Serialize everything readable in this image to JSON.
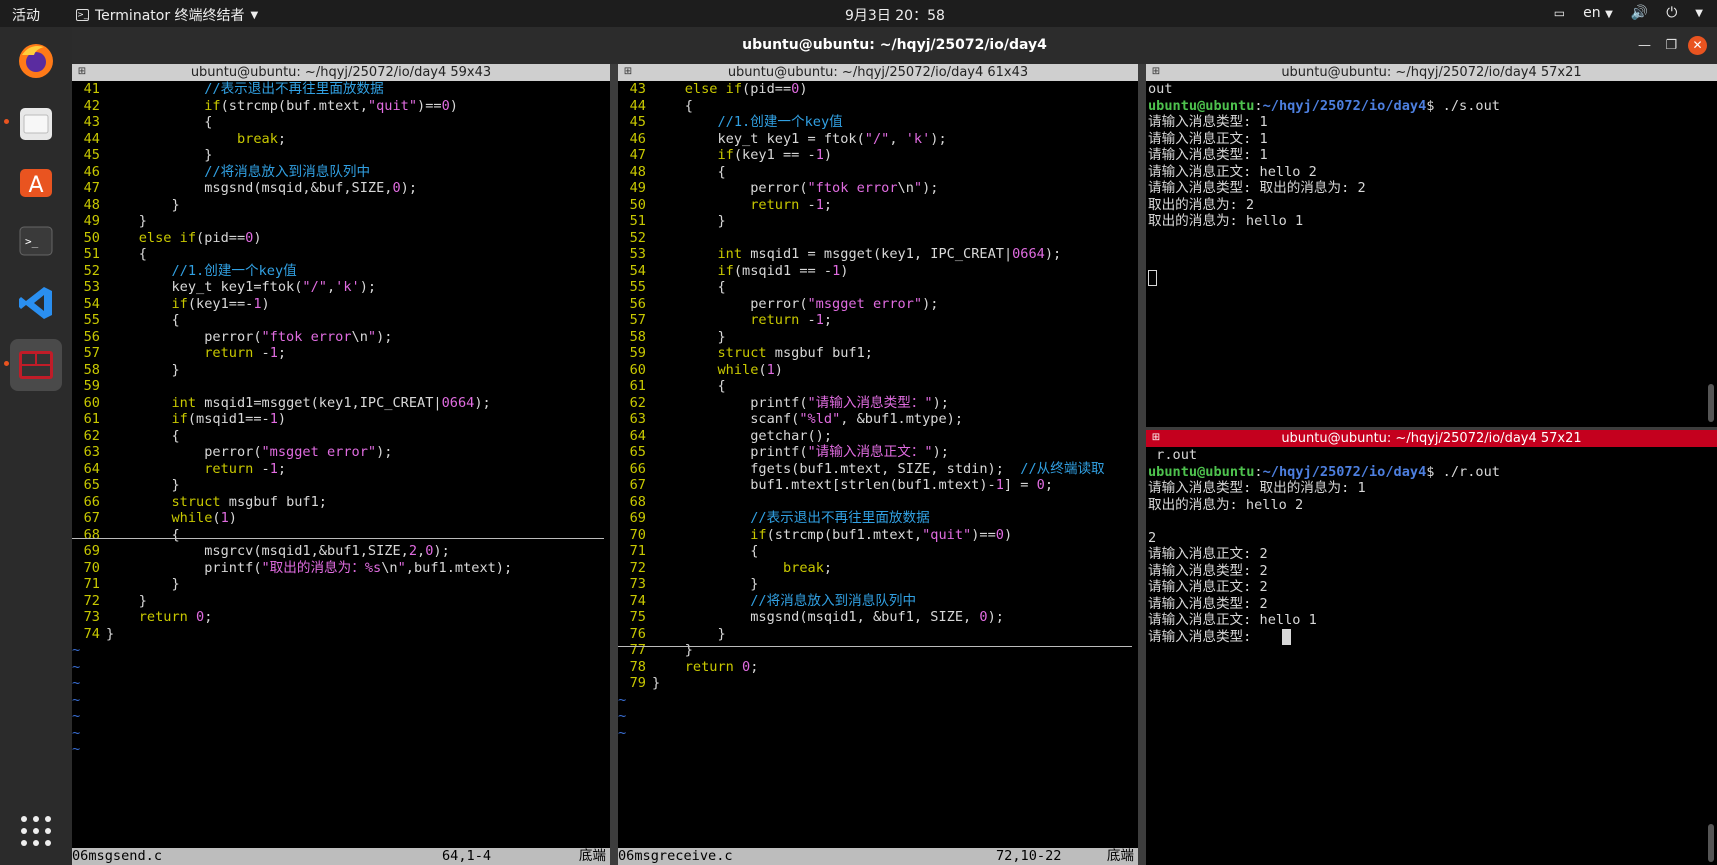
{
  "topbar": {
    "activities": "活动",
    "app_name": "Terminator 终端终结者",
    "clock": "9月3日  20：58",
    "lang": "en"
  },
  "window": {
    "title": "ubuntu@ubuntu: ~/hqyj/25072/io/day4"
  },
  "panes": {
    "left": {
      "title": "ubuntu@ubuntu: ~/hqyj/25072/io/day4 59x43",
      "status_file": "06msgsend.c",
      "status_pos": "64,1-4",
      "status_end": "底端"
    },
    "middle": {
      "title": "ubuntu@ubuntu: ~/hqyj/25072/io/day4 61x43",
      "status_file": "06msgreceive.c",
      "status_pos": "72,10-22",
      "status_end": "底端"
    },
    "top_right": {
      "title": "ubuntu@ubuntu: ~/hqyj/25072/io/day4 57x21"
    },
    "bottom_right": {
      "title": "ubuntu@ubuntu: ~/hqyj/25072/io/day4 57x21"
    }
  },
  "left_code": [
    [
      "41",
      "            <span class='cmt'>//表示退出不再往里面放数据</span>"
    ],
    [
      "42",
      "            <span class='kw'>if</span>(strcmp(buf.mtext,<span class='str'>\"quit\"</span>)==<span class='str'>0</span>)"
    ],
    [
      "43",
      "            {"
    ],
    [
      "44",
      "                <span class='kw'>break</span>;"
    ],
    [
      "45",
      "            }"
    ],
    [
      "46",
      "            <span class='cmt'>//将消息放入到消息队列中</span>"
    ],
    [
      "47",
      "            msgsnd(msqid,&amp;buf,SIZE,<span class='str'>0</span>);"
    ],
    [
      "48",
      "        }"
    ],
    [
      "49",
      "    }"
    ],
    [
      "50",
      "    <span class='kw'>else if</span>(pid==<span class='str'>0</span>)"
    ],
    [
      "51",
      "    {"
    ],
    [
      "52",
      "        <span class='cmt'>//1.创建一个key值</span>"
    ],
    [
      "53",
      "        key_t key1=ftok(<span class='str'>\"/\"</span>,<span class='str'>'k'</span>);"
    ],
    [
      "54",
      "        <span class='kw'>if</span>(key1==-<span class='str'>1</span>)"
    ],
    [
      "55",
      "        {"
    ],
    [
      "56",
      "            perror(<span class='str'>\"ftok error</span>\\n<span class='str'>\"</span>);"
    ],
    [
      "57",
      "            <span class='kw'>return</span> -<span class='str'>1</span>;"
    ],
    [
      "58",
      "        }"
    ],
    [
      "59",
      ""
    ],
    [
      "60",
      "        <span class='kw'>int</span> msqid1=msgget(key1,IPC_CREAT|<span class='str'>0664</span>);"
    ],
    [
      "61",
      "        <span class='kw'>if</span>(msqid1==-<span class='str'>1</span>)"
    ],
    [
      "62",
      "        {"
    ],
    [
      "63",
      "            perror(<span class='str'>\"msgget error\"</span>);"
    ],
    [
      "64",
      "            <span class='kw'>return</span> -<span class='str'>1</span>;"
    ],
    [
      "65",
      "        }"
    ],
    [
      "66",
      "        <span class='kw'>struct</span> msgbuf buf1;"
    ],
    [
      "67",
      "        <span class='kw'>while</span>(<span class='str'>1</span>)"
    ],
    [
      "68",
      "        {"
    ],
    [
      "69",
      "            msgrcv(msqid1,&amp;buf1,SIZE,<span class='str'>2</span>,<span class='str'>0</span>);"
    ],
    [
      "70",
      "            printf(<span class='str'>\"取出的消息为：%s</span>\\n<span class='str'>\"</span>,buf1.mtext);"
    ],
    [
      "71",
      "        }"
    ],
    [
      "72",
      "    }"
    ],
    [
      "73",
      "    <span class='kw'>return</span> <span class='str'>0</span>;"
    ],
    [
      "74",
      "}"
    ]
  ],
  "middle_code": [
    [
      "43",
      "    <span class='kw'>else if</span>(pid==<span class='str'>0</span>)"
    ],
    [
      "44",
      "    {"
    ],
    [
      "45",
      "        <span class='cmt'>//1.创建一个key值</span>"
    ],
    [
      "46",
      "        key_t key1 = ftok(<span class='str'>\"/\"</span>, <span class='str'>'k'</span>);"
    ],
    [
      "47",
      "        <span class='kw'>if</span>(key1 == -<span class='str'>1</span>)"
    ],
    [
      "48",
      "        {"
    ],
    [
      "49",
      "            perror(<span class='str'>\"ftok error</span>\\n<span class='str'>\"</span>);"
    ],
    [
      "50",
      "            <span class='kw'>return</span> -<span class='str'>1</span>;"
    ],
    [
      "51",
      "        }"
    ],
    [
      "52",
      ""
    ],
    [
      "53",
      "        <span class='kw'>int</span> msqid1 = msgget(key1, IPC_CREAT|<span class='str'>0664</span>);"
    ],
    [
      "54",
      "        <span class='kw'>if</span>(msqid1 == -<span class='str'>1</span>)"
    ],
    [
      "55",
      "        {"
    ],
    [
      "56",
      "            perror(<span class='str'>\"msgget error\"</span>);"
    ],
    [
      "57",
      "            <span class='kw'>return</span> -<span class='str'>1</span>;"
    ],
    [
      "58",
      "        }"
    ],
    [
      "59",
      "        <span class='kw'>struct</span> msgbuf buf1;"
    ],
    [
      "60",
      "        <span class='kw'>while</span>(<span class='str'>1</span>)"
    ],
    [
      "61",
      "        {"
    ],
    [
      "62",
      "            printf(<span class='str'>\"请输入消息类型：\"</span>);"
    ],
    [
      "63",
      "            scanf(<span class='str'>\"%ld\"</span>, &amp;buf1.mtype);"
    ],
    [
      "64",
      "            getchar();"
    ],
    [
      "65",
      "            printf(<span class='str'>\"请输入消息正文：\"</span>);"
    ],
    [
      "66",
      "            fgets(buf1.mtext, SIZE, stdin);  <span class='cmt'>//从终端读取</span>"
    ],
    [
      "67",
      "            buf1.mtext[strlen(buf1.mtext)-<span class='str'>1</span>] = <span class='str'>0</span>;"
    ],
    [
      "68",
      ""
    ],
    [
      "69",
      "            <span class='cmt'>//表示退出不再往里面放数据</span>"
    ],
    [
      "70",
      "            <span class='kw'>if</span>(strcmp(buf1.mtext,<span class='str'>\"quit\"</span>)==<span class='str'>0</span>)"
    ],
    [
      "71",
      "            {"
    ],
    [
      "72",
      "                <span class='kw'>break</span>;"
    ],
    [
      "73",
      "            }"
    ],
    [
      "74",
      "            <span class='cmt'>//将消息放入到消息队列中</span>"
    ],
    [
      "75",
      "            msgsnd(msqid1, &amp;buf1, SIZE, <span class='str'>0</span>);"
    ],
    [
      "76",
      "        }"
    ],
    [
      "77",
      "    }"
    ],
    [
      "78",
      "    <span class='kw'>return</span> <span class='str'>0</span>;"
    ],
    [
      "79",
      "}"
    ]
  ],
  "top_right_lines": [
    "out",
    "<span class='pg'>ubuntu@ubuntu</span>:<span class='pb'>~/hqyj/25072/io/day4</span>$ ./s.out",
    "请输入消息类型: 1",
    "请输入消息正文: 1",
    "请输入消息类型: 1",
    "请输入消息正文: hello 2",
    "请输入消息类型: 取出的消息为: 2",
    "取出的消息为: 2",
    "取出的消息为: hello 1"
  ],
  "bottom_right_lines": [
    " r.out",
    "<span class='pg'>ubuntu@ubuntu</span>:<span class='pb'>~/hqyj/25072/io/day4</span>$ ./r.out",
    "请输入消息类型: 取出的消息为: 1",
    "取出的消息为: hello 2",
    "",
    "2",
    "请输入消息正文: 2",
    "请输入消息类型: 2",
    "请输入消息正文: 2",
    "请输入消息类型: 2",
    "请输入消息正文: hello 1",
    "请输入消息类型: "
  ]
}
